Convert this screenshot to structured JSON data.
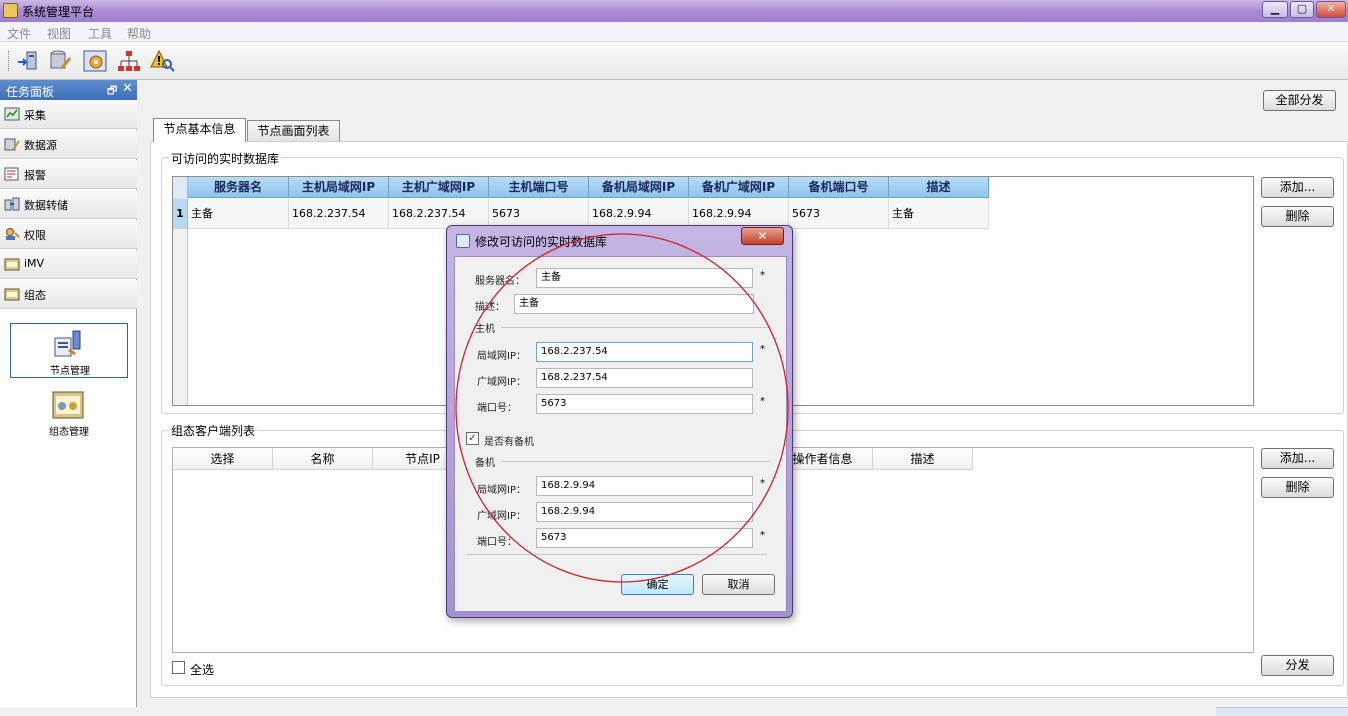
{
  "window": {
    "title": "系统管理平台",
    "btn_min": "▁",
    "btn_max": "▢",
    "btn_close": "✕"
  },
  "menu": [
    "文件",
    "视图",
    "工具",
    "帮助"
  ],
  "toolbar": {
    "icons": [
      "connect-icon",
      "database-tools-icon",
      "settings-gear-icon",
      "network-tree-icon",
      "alert-search-icon"
    ]
  },
  "task_panel": {
    "title": "任务面板",
    "pin": "🗗",
    "close": "✕",
    "items": [
      {
        "label": "采集",
        "icon": "collect-icon"
      },
      {
        "label": "数据源",
        "icon": "datasource-icon"
      },
      {
        "label": "报警",
        "icon": "alarm-icon"
      },
      {
        "label": "数据转储",
        "icon": "data-dump-icon"
      },
      {
        "label": "权限",
        "icon": "permission-icon"
      },
      {
        "label": "iMV",
        "icon": "imv-icon"
      },
      {
        "label": "组态",
        "icon": "config-icon"
      }
    ],
    "big_items": [
      {
        "label": "节点管理",
        "icon": "node-manage-icon"
      },
      {
        "label": "组态管理",
        "icon": "config-manage-icon"
      }
    ]
  },
  "main": {
    "distribute_all": "全部分发",
    "tabs": [
      "节点基本信息",
      "节点画面列表"
    ],
    "db_group_title": "可访问的实时数据库",
    "db_columns": [
      "服务器名",
      "主机局域网IP",
      "主机广域网IP",
      "主机端口号",
      "备机局域网IP",
      "备机广域网IP",
      "备机端口号",
      "描述"
    ],
    "db_rows": [
      {
        "index": "1",
        "cells": [
          "主备",
          "168.2.237.54",
          "168.2.237.54",
          "5673",
          "168.2.9.94",
          "168.2.9.94",
          "5673",
          "主备"
        ]
      }
    ],
    "db_add": "添加...",
    "db_delete": "删除",
    "client_group_title": "组态客户端列表",
    "client_columns": [
      "选择",
      "名称",
      "节点IP",
      "",
      "",
      "",
      "操作者信息",
      "描述"
    ],
    "client_add": "添加...",
    "client_delete": "删除",
    "select_all": "全选",
    "distribute": "分发"
  },
  "dialog": {
    "title": "修改可访问的实时数据库",
    "close": "✕",
    "server_name_label": "服务器名：",
    "server_name_value": "主备",
    "desc_label": "描述：",
    "desc_value": "主备",
    "host_group": "主机",
    "host_lan_label": "局域网IP：",
    "host_lan_value": "168.2.237.54",
    "host_wan_label": "广域网IP：",
    "host_wan_value": "168.2.237.54",
    "host_port_label": "端口号：",
    "host_port_value": "5673",
    "has_backup_label": "是否有备机",
    "has_backup_checked": "✓",
    "backup_group": "备机",
    "backup_lan_label": "局域网IP：",
    "backup_lan_value": "168.2.9.94",
    "backup_wan_label": "广域网IP：",
    "backup_wan_value": "168.2.9.94",
    "backup_port_label": "端口号：",
    "backup_port_value": "5673",
    "required": "*",
    "ok": "确定",
    "cancel": "取消"
  },
  "colors": {
    "annotation_circle": "#d0202a",
    "grid_header": "#9fcff1",
    "dialog_frame": "#b6a3dc"
  }
}
